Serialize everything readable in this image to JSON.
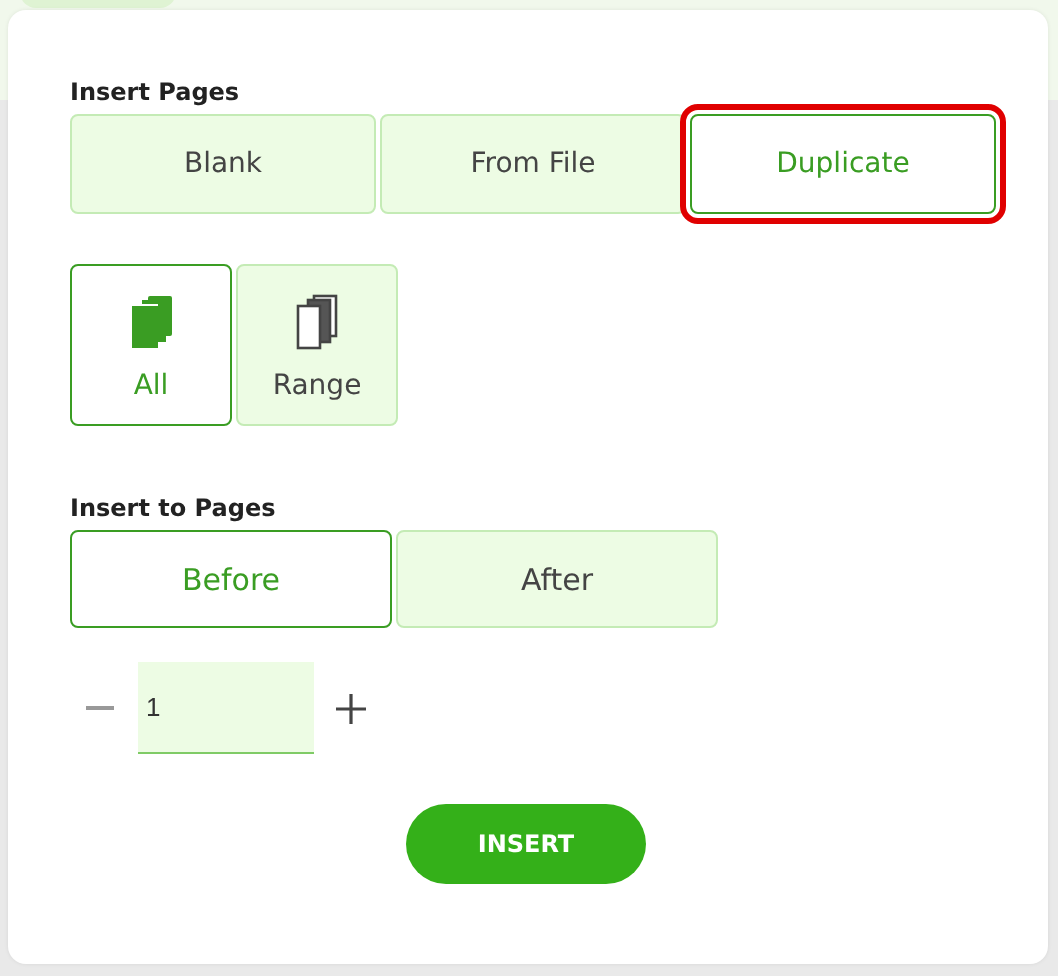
{
  "insert_pages": {
    "label": "Insert Pages",
    "options": [
      {
        "label": "Blank",
        "selected": false,
        "highlighted": false
      },
      {
        "label": "From File",
        "selected": false,
        "highlighted": false
      },
      {
        "label": "Duplicate",
        "selected": true,
        "highlighted": true
      }
    ]
  },
  "page_scope": [
    {
      "kind": "all",
      "label": "All",
      "selected": true
    },
    {
      "kind": "range",
      "label": "Range",
      "selected": false
    }
  ],
  "insert_to_pages": {
    "label": "Insert to Pages",
    "options": [
      {
        "label": "Before",
        "selected": true
      },
      {
        "label": "After",
        "selected": false
      }
    ]
  },
  "page_number": {
    "value": "1"
  },
  "insert_button": "INSERT"
}
